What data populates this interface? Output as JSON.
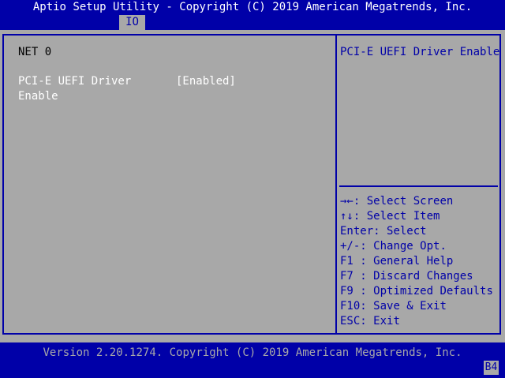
{
  "header": {
    "title": "Aptio Setup Utility - Copyright (C) 2019 American Megatrends, Inc."
  },
  "tabs": [
    {
      "label": "IO",
      "selected": true
    }
  ],
  "main": {
    "section_title": "NET 0",
    "setting": {
      "label_line1": "PCI-E UEFI Driver",
      "label_line2": "Enable",
      "value": "[Enabled]"
    }
  },
  "help": {
    "description": "PCI-E UEFI Driver Enable",
    "keys": [
      {
        "key": "→←:",
        "action": "Select Screen"
      },
      {
        "key": "↑↓:",
        "action": "Select Item"
      },
      {
        "key": "Enter:",
        "action": "Select"
      },
      {
        "key": "+/-:",
        "action": "Change Opt."
      },
      {
        "key": "F1 :",
        "action": "General Help"
      },
      {
        "key": "F7 :",
        "action": "Discard Changes"
      },
      {
        "key": "F9 :",
        "action": "Optimized Defaults"
      },
      {
        "key": "F10:",
        "action": "Save & Exit"
      },
      {
        "key": "ESC:",
        "action": "Exit"
      }
    ]
  },
  "footer": {
    "version": "Version 2.20.1274. Copyright (C) 2019 American Megatrends, Inc.",
    "badge": "B4"
  },
  "colors": {
    "background_blue": "#0000a8",
    "panel_gray": "#a8a8a8",
    "text_white": "#ffffff",
    "text_black": "#000000"
  }
}
